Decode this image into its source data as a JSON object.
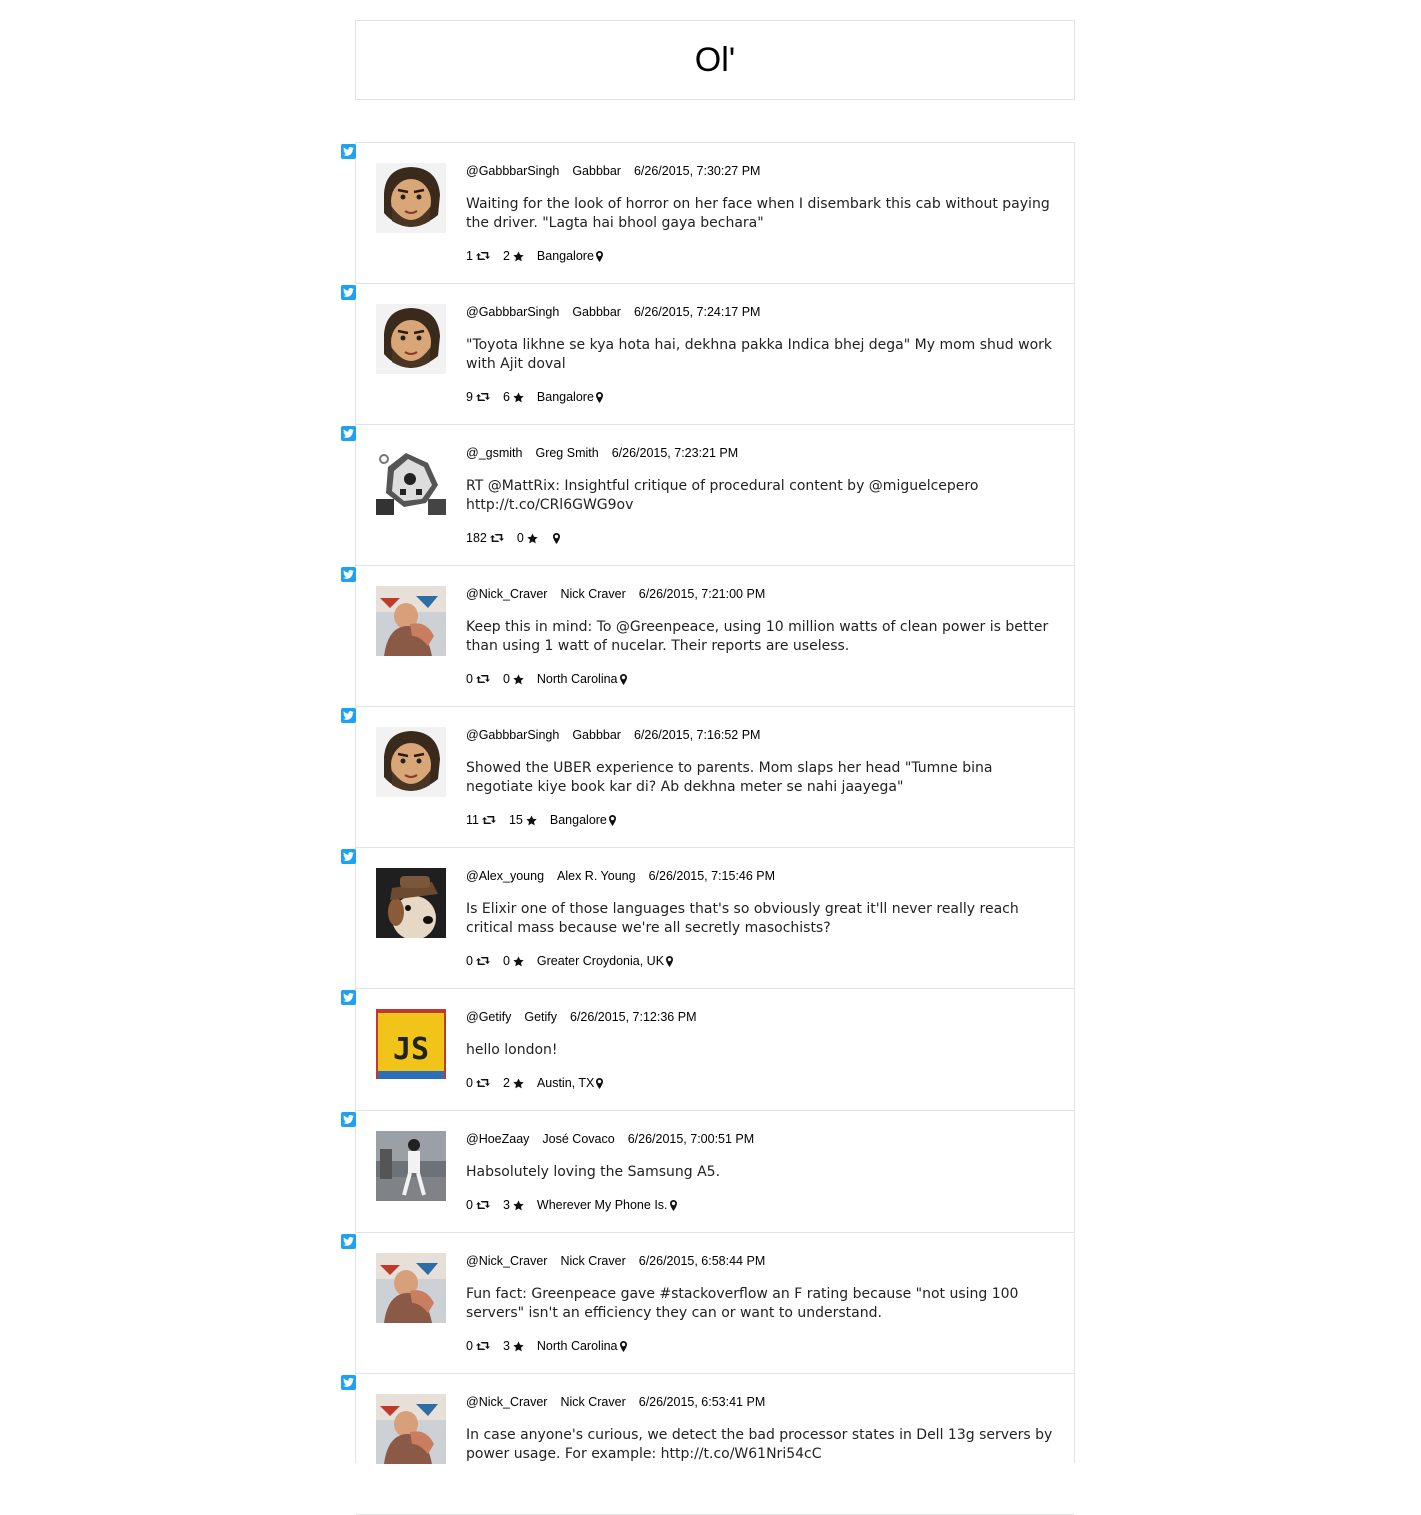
{
  "header": {
    "title": "Ol'"
  },
  "tweets": [
    {
      "handle": "@GabbbarSingh",
      "name": "Gabbbar",
      "time": "6/26/2015, 7:30:27 PM",
      "text": "Waiting for the look of horror on her face when I disembark this cab without paying the driver. \"Lagta hai bhool gaya bechara\"",
      "retweets": "1",
      "favorites": "2",
      "location": "Bangalore",
      "avatar": "gabbar"
    },
    {
      "handle": "@GabbbarSingh",
      "name": "Gabbbar",
      "time": "6/26/2015, 7:24:17 PM",
      "text": "\"Toyota likhne se kya hota hai, dekhna pakka Indica bhej dega\" My mom shud work with Ajit doval",
      "retweets": "9",
      "favorites": "6",
      "location": "Bangalore",
      "avatar": "gabbar"
    },
    {
      "handle": "@_gsmith",
      "name": "Greg Smith",
      "time": "6/26/2015, 7:23:21 PM",
      "text": "RT @MattRix: Insightful critique of procedural content by @miguelcepero http://t.co/CRl6GWG9ov",
      "retweets": "182",
      "favorites": "0",
      "location": "",
      "avatar": "pixel"
    },
    {
      "handle": "@Nick_Craver",
      "name": "Nick Craver",
      "time": "6/26/2015, 7:21:00 PM",
      "text": "Keep this in mind: To @Greenpeace, using 10 million watts of clean power is better than using 1 watt of nucelar. Their reports are useless.",
      "retweets": "0",
      "favorites": "0",
      "location": "North Carolina",
      "avatar": "nick"
    },
    {
      "handle": "@GabbbarSingh",
      "name": "Gabbbar",
      "time": "6/26/2015, 7:16:52 PM",
      "text": "Showed the UBER experience to parents. Mom slaps her head \"Tumne bina negotiate kiye book kar di? Ab dekhna meter se nahi jaayega\"",
      "retweets": "11",
      "favorites": "15",
      "location": "Bangalore",
      "avatar": "gabbar"
    },
    {
      "handle": "@Alex_young",
      "name": "Alex R. Young",
      "time": "6/26/2015, 7:15:46 PM",
      "text": "Is Elixir one of those languages that's so obviously great it'll never really reach critical mass because we're all secretly masochists?",
      "retweets": "0",
      "favorites": "0",
      "location": "Greater Croydonia, UK",
      "avatar": "dog"
    },
    {
      "handle": "@Getify",
      "name": "Getify",
      "time": "6/26/2015, 7:12:36 PM",
      "text": "hello london!",
      "retweets": "0",
      "favorites": "2",
      "location": "Austin, TX",
      "avatar": "js",
      "short": true
    },
    {
      "handle": "@HoeZaay",
      "name": "José Covaco",
      "time": "6/26/2015, 7:00:51 PM",
      "text": "Habsolutely loving the Samsung A5.",
      "retweets": "0",
      "favorites": "3",
      "location": "Wherever My Phone Is.",
      "avatar": "street",
      "short": true
    },
    {
      "handle": "@Nick_Craver",
      "name": "Nick Craver",
      "time": "6/26/2015, 6:58:44 PM",
      "text": "Fun fact: Greenpeace gave #stackoverflow an F rating because \"not using 100 servers\" isn't an efficiency they can or want to understand.",
      "retweets": "0",
      "favorites": "3",
      "location": "North Carolina",
      "avatar": "nick"
    },
    {
      "handle": "@Nick_Craver",
      "name": "Nick Craver",
      "time": "6/26/2015, 6:53:41 PM",
      "text": "In case anyone's curious, we detect the bad processor states in Dell 13g servers by power usage. For example: http://t.co/W61Nri54cC",
      "retweets": "",
      "favorites": "",
      "location": "",
      "avatar": "nick"
    }
  ]
}
